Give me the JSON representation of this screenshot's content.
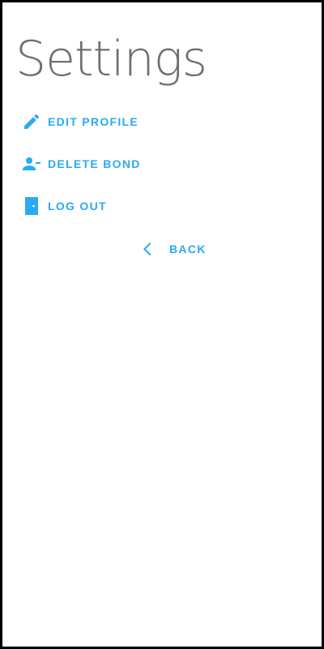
{
  "page": {
    "title": "Settings"
  },
  "menu": {
    "items": [
      {
        "label": "EDIT PROFILE",
        "icon": "pencil-icon"
      },
      {
        "label": "DELETE BOND",
        "icon": "person-remove-icon"
      },
      {
        "label": "LOG OUT",
        "icon": "door-icon"
      }
    ]
  },
  "back": {
    "label": "BACK",
    "icon": "chevron-left-icon"
  },
  "colors": {
    "accent": "#2aaaf2",
    "title": "#6f6f6f",
    "background": "#ffffff",
    "border": "#000000"
  }
}
